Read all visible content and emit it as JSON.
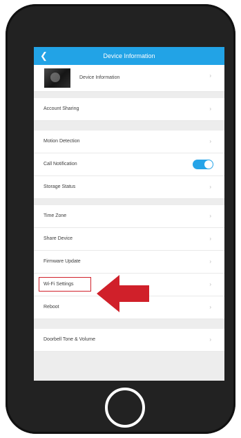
{
  "header": {
    "title": "Device Information",
    "back_icon": "back-arrow-icon"
  },
  "device": {
    "label": "Device Information",
    "thumb_icon": "device-thumbnail-icon"
  },
  "rows": {
    "account_sharing": "Account Sharing",
    "motion_detection": "Motion Detection",
    "call_notification": "Call Notification",
    "call_notification_enabled": true,
    "storage_status": "Storage Status",
    "time_zone": "Time Zone",
    "share_device": "Share Device",
    "firmware_update": "Firmware Update",
    "wifi_settings": "Wi-Fi Settings",
    "reboot": "Reboot",
    "doorbell_tone_volume": "Doorbell Tone & Volume"
  },
  "chevron_glyph": "›",
  "colors": {
    "accent": "#22a3e6",
    "highlight": "#d0202a",
    "phone_body": "#222222"
  },
  "annotations": {
    "highlighted_row": "wifi_settings",
    "arrow_icon": "red-arrow-icon"
  }
}
